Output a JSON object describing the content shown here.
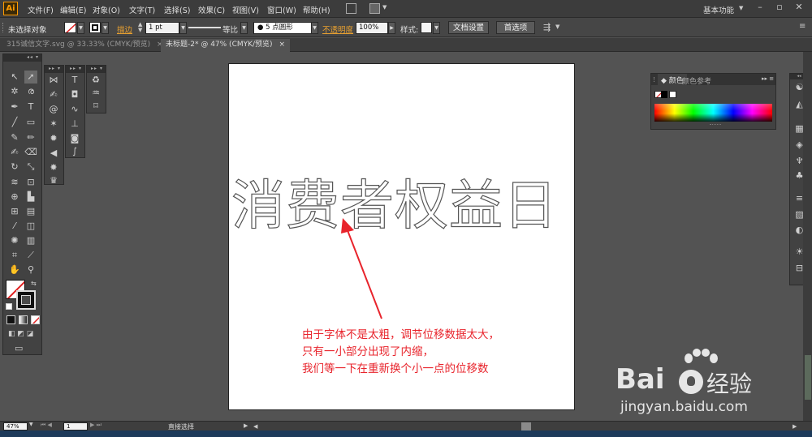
{
  "app": {
    "logo": "Ai",
    "brand_color": "#ff9a00"
  },
  "menu": [
    "文件(F)",
    "编辑(E)",
    "对象(O)",
    "文字(T)",
    "选择(S)",
    "效果(C)",
    "视图(V)",
    "窗口(W)",
    "帮助(H)"
  ],
  "workspace": {
    "label": "基本功能"
  },
  "controlbar": {
    "selection_label": "未选择对象",
    "stroke_label": "描边",
    "stroke_weight": "1 pt",
    "stroke_profile": "等比",
    "brush": "5 点圆形",
    "opacity_label": "不透明度",
    "opacity_value": "100%",
    "style_label": "样式:",
    "doc_setup": "文档设置",
    "preferences": "首选项"
  },
  "tabs": [
    {
      "label": "315诚信文字.svg @ 33.33% (CMYK/预览)",
      "close": "×"
    },
    {
      "label": "未标题-2* @ 47% (CMYK/预览)",
      "close": "×"
    }
  ],
  "artwork": {
    "outlined_text": "消费者权益日"
  },
  "annotation": {
    "line1": "由于字体不是太粗，调节位移数据太大，",
    "line2": "只有一小部分出现了内缩，",
    "line3": "我们等一下在重新换个小一点的位移数"
  },
  "color_panel": {
    "tab_color": "颜色",
    "tab_guide": "颜色参考"
  },
  "statusbar": {
    "zoom": "47%",
    "page": "1",
    "tool_name": "直接选择"
  },
  "watermark": {
    "text": "Bai",
    "text2": "经验",
    "url": "jingyan.baidu.com"
  },
  "colors": {
    "annotation": "#e8242c",
    "arrow": "#e8242c"
  }
}
